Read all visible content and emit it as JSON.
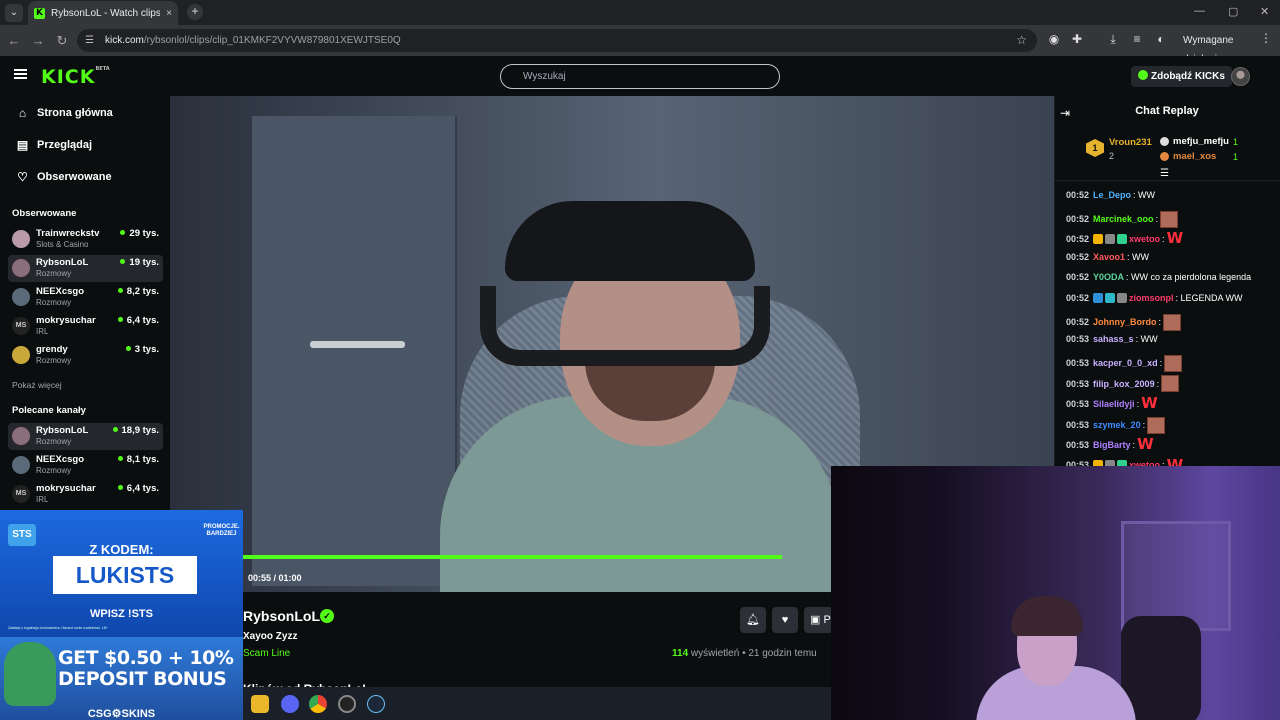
{
  "browser": {
    "tab_title": "RybsonLoL - Watch clips on Kick",
    "tab_favicon": "K",
    "tab_close": "×",
    "new_tab": "+",
    "url_host": "kick.com",
    "url_path": "/rybsonlol/clips/clip_01KMKF2VYVW879801XEWJTSE0Q",
    "action_required": "Wymagane działanie",
    "icons": [
      "back-icon",
      "forward-icon",
      "reload-icon",
      "site-info-icon",
      "bookmark-star-icon",
      "extension-icon",
      "download-icon",
      "media-icon",
      "profile-icon",
      "menu-icon"
    ]
  },
  "header": {
    "logo": "KICK",
    "logo_beta": "BETA",
    "search_placeholder": "Wyszukaj",
    "get_kicks": "Zdobądź KICKs"
  },
  "sidebar": {
    "nav": [
      {
        "label": "Strona główna",
        "icon": "home-icon"
      },
      {
        "label": "Przeglądaj",
        "icon": "browse-icon"
      },
      {
        "label": "Obserwowane",
        "icon": "heart-icon"
      }
    ],
    "followed_title": "Obserwowane",
    "followed": [
      {
        "name": "Trainwreckstv",
        "category": "Slots & Casino",
        "viewers": "29 tys."
      },
      {
        "name": "RybsonLoL",
        "category": "Rozmowy",
        "viewers": "19 tys."
      },
      {
        "name": "NEEXcsgo",
        "category": "Rozmowy",
        "viewers": "8,2 tys."
      },
      {
        "name": "mokrysuchar",
        "category": "IRL",
        "viewers": "6,4 tys."
      },
      {
        "name": "grendy",
        "category": "Rozmowy",
        "viewers": "3 tys."
      }
    ],
    "show_more": "Pokaż więcej",
    "recommended_title": "Polecane kanały",
    "recommended": [
      {
        "name": "RybsonLoL",
        "category": "Rozmowy",
        "viewers": "18,9 tys."
      },
      {
        "name": "NEEXcsgo",
        "category": "Rozmowy",
        "viewers": "8,1 tys."
      },
      {
        "name": "mokrysuchar",
        "category": "IRL",
        "viewers": "6,4 tys."
      }
    ]
  },
  "video": {
    "time": "00:55 / 01:00",
    "progress": 0.917,
    "channel": "RybsonLoL",
    "clip_title": "Xayoo Zyzz",
    "category": "Scam Line",
    "views_count": "114",
    "views_label": "wyświetleń",
    "age": "• 21 godzin temu",
    "more_from": "Klipów od RybsonLoL",
    "gift_label": "P"
  },
  "chat": {
    "title": "Chat Replay",
    "leaderboard": [
      {
        "rank": "1",
        "name": "Vroun231",
        "count": "2",
        "color": "#e5b32e"
      },
      {
        "name": "mefju_mefju",
        "count": "1",
        "color": "#ffffff"
      },
      {
        "name": "mael_xos",
        "count": "1",
        "color": "#e3883e"
      }
    ],
    "messages": [
      {
        "ts": "00:52",
        "user": "Le_Depo",
        "color": "#4fb3ff",
        "text": ": WW",
        "emote": ""
      },
      {
        "ts": "00:52",
        "user": "Marcinek_ooo",
        "color": "#53fc18",
        "text": ":",
        "emote": "img"
      },
      {
        "ts": "00:52",
        "user": "xwetoo",
        "color": "#ff3b6b",
        "text": ":",
        "emote": "W",
        "badges": [
          "#f5b300",
          "#888",
          "#2fd18c"
        ]
      },
      {
        "ts": "00:52",
        "user": "Xavoo1",
        "color": "#ff5a5a",
        "text": ": WW",
        "emote": ""
      },
      {
        "ts": "00:52",
        "user": "Y0ODA",
        "color": "#5dd5a0",
        "text": ": WW co za pierdolona legenda",
        "emote": ""
      },
      {
        "ts": "00:52",
        "user": "ziomsonpl",
        "color": "#ff3b6b",
        "text": ": LEGENDA WW",
        "emote": "",
        "badges": [
          "#2f8fd8",
          "#2fb8c8",
          "#888"
        ]
      },
      {
        "ts": "00:52",
        "user": "Johnny_Bordo",
        "color": "#ff8a3d",
        "text": ":",
        "emote": "img"
      },
      {
        "ts": "00:53",
        "user": "sahass_s",
        "color": "#c9b0ff",
        "text": ": WW",
        "emote": ""
      },
      {
        "ts": "00:53",
        "user": "kacper_0_0_xd",
        "color": "#c9b0ff",
        "text": ":",
        "emote": "img"
      },
      {
        "ts": "00:53",
        "user": "filip_kox_2009",
        "color": "#c9b0ff",
        "text": ":",
        "emote": "img"
      },
      {
        "ts": "00:53",
        "user": "Silaelidyji",
        "color": "#b080ff",
        "text": ":",
        "emote": "W"
      },
      {
        "ts": "00:53",
        "user": "szymek_20",
        "color": "#3f8cff",
        "text": ":",
        "emote": "img"
      },
      {
        "ts": "00:53",
        "user": "BigBarty",
        "color": "#b080ff",
        "text": ":",
        "emote": "W"
      },
      {
        "ts": "00:53",
        "user": "xwetoo",
        "color": "#ff3b6b",
        "text": ":",
        "emote": "W",
        "badges": [
          "#f5b300",
          "#888",
          "#2fd18c"
        ]
      }
    ]
  },
  "ad": {
    "brand": "STS",
    "promo": "PROMOCJE. BARDZIEJ",
    "with_code": "Z KODEM:",
    "code": "LUKISTS",
    "enter": "WPISZ !STS",
    "fine_print": "Zakłady u legalnego bukmachera. Hazard może uzależniać. 18+",
    "bonus_line1": "GET $0.50 + 10%",
    "bonus_line2": "DEPOSIT BONUS",
    "csg": "CSG⚙SKINS"
  },
  "taskbar": {
    "icons": [
      "file-explorer-icon",
      "discord-icon",
      "chrome-icon",
      "obs-icon",
      "steam-icon"
    ]
  }
}
